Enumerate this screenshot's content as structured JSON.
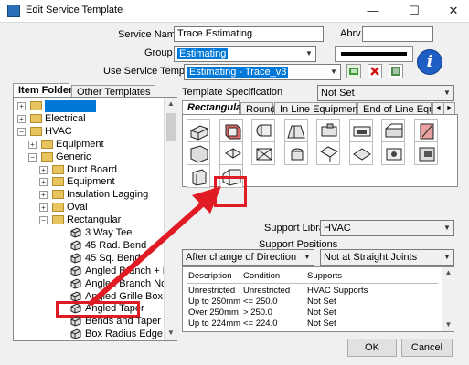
{
  "window": {
    "title": "Edit Service Template",
    "minimize": "—",
    "maximize": "☐",
    "close": "✕"
  },
  "service": {
    "name_label": "Service Name",
    "name_value": "Trace Estimating",
    "abrv_label": "Abrv",
    "abrv_value": "",
    "group_label": "Group",
    "group_value": "Estimating",
    "use_template_label": "Use Service Template",
    "use_template_value": "Estimating - Trace_v3"
  },
  "left_tabs": [
    "Item Folders",
    "Other Templates"
  ],
  "tree": {
    "items": [
      {
        "label": "",
        "type": "folder",
        "level": 0,
        "expander": "+",
        "selected": true
      },
      {
        "label": "Electrical",
        "type": "folder",
        "level": 0,
        "expander": "+"
      },
      {
        "label": "HVAC",
        "type": "folder",
        "level": 0,
        "expander": "−"
      },
      {
        "label": "Equipment",
        "type": "folder",
        "level": 1,
        "expander": "+"
      },
      {
        "label": "Generic",
        "type": "folder",
        "level": 1,
        "expander": "−"
      },
      {
        "label": "Duct Board",
        "type": "folder",
        "level": 2,
        "expander": "+"
      },
      {
        "label": "Equipment",
        "type": "folder",
        "level": 2,
        "expander": "+"
      },
      {
        "label": "Insulation Lagging",
        "type": "folder",
        "level": 2,
        "expander": "+"
      },
      {
        "label": "Oval",
        "type": "folder",
        "level": 2,
        "expander": "+"
      },
      {
        "label": "Rectangular",
        "type": "folder",
        "level": 2,
        "expander": "−"
      },
      {
        "label": "3 Way Tee",
        "type": "part",
        "level": 3
      },
      {
        "label": "45 Rad. Bend",
        "type": "part",
        "level": 3
      },
      {
        "label": "45 Sq. Bend",
        "type": "part",
        "level": 3
      },
      {
        "label": "Angled Branch + Plate",
        "type": "part",
        "level": 3
      },
      {
        "label": "Angled Branch No Pl",
        "type": "part",
        "level": 3
      },
      {
        "label": "Angled Grille Box",
        "type": "part",
        "level": 3
      },
      {
        "label": "Angled Taper",
        "type": "part",
        "level": 3,
        "highlight": true
      },
      {
        "label": "Bends and Taper Sepe",
        "type": "part",
        "level": 3
      },
      {
        "label": "Box Radius Edge",
        "type": "part",
        "level": 3
      }
    ]
  },
  "template_spec": {
    "label": "Template Specification",
    "value": "Not Set"
  },
  "right_tabs": [
    "Rectangular",
    "Round",
    "In Line Equipment",
    "End of Line Equi"
  ],
  "tab_scroll": {
    "left": "◄",
    "right": "►"
  },
  "support": {
    "library_label": "Support Library",
    "library_value": "HVAC",
    "positions_label": "Support Positions",
    "positions_left": "After change of Direction",
    "positions_right": "Not at Straight Joints"
  },
  "conditions": {
    "headers": [
      "Description",
      "Condition",
      "Supports"
    ],
    "rows": [
      [
        "Unrestricted",
        "Unrestricted",
        "HVAC Supports"
      ],
      [
        "Up to 250mm",
        "<= 250.0",
        "Not Set"
      ],
      [
        "Over 250mm",
        "> 250.0",
        "Not Set"
      ],
      [
        "Up to 224mm",
        "<= 224.0",
        "Not Set"
      ]
    ]
  },
  "buttons": {
    "ok": "OK",
    "cancel": "Cancel"
  },
  "icons": {
    "info": "i",
    "color_swatch": "#000000",
    "highlight_color": "#e01b24",
    "selection_color": "#0078d7"
  }
}
